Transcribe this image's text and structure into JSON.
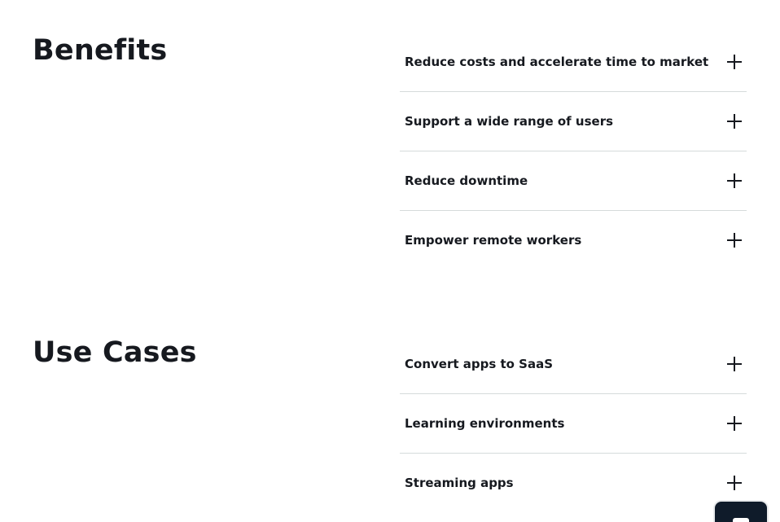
{
  "benefits": {
    "title": "Benefits",
    "items": [
      {
        "label": "Reduce costs and accelerate time to market"
      },
      {
        "label": "Support a wide range of users"
      },
      {
        "label": "Reduce downtime"
      },
      {
        "label": "Empower remote workers"
      }
    ]
  },
  "use_cases": {
    "title": "Use Cases",
    "items": [
      {
        "label": "Convert apps to SaaS"
      },
      {
        "label": "Learning environments"
      },
      {
        "label": "Streaming apps"
      }
    ]
  },
  "icons": {
    "expand": "plus-icon",
    "chat": "chat-icon"
  },
  "colors": {
    "text": "#16191f",
    "divider": "#d5dbdb",
    "chat_bg": "#0f1b2a"
  }
}
